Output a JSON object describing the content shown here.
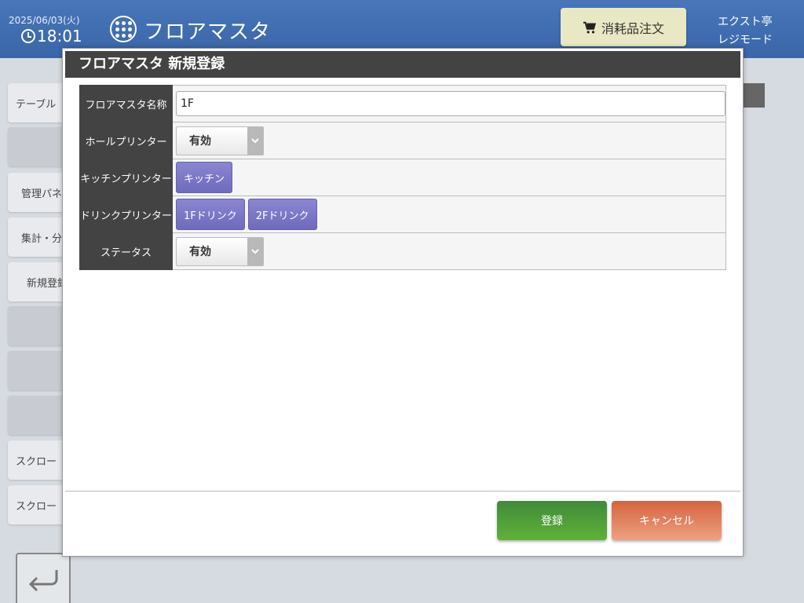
{
  "header": {
    "date": "2025/06/03(火)",
    "time": "18:01",
    "app_title": "フロアマスタ",
    "order_button": "消耗品注文",
    "store_name": "エクスト亭",
    "mode": "レジモード"
  },
  "sidebar": {
    "items": [
      {
        "label": "テーブル"
      },
      {
        "label": ""
      },
      {
        "label": "管理パネ"
      },
      {
        "label": "集計・分"
      },
      {
        "label": "新規登録"
      },
      {
        "label": ""
      },
      {
        "label": ""
      },
      {
        "label": ""
      },
      {
        "label": "スクロー"
      },
      {
        "label": "スクロー"
      }
    ]
  },
  "modal": {
    "title": "フロアマスタ 新規登録",
    "fields": {
      "name": {
        "label": "フロアマスタ名称",
        "value": "1F"
      },
      "hall_printer": {
        "label": "ホールプリンター",
        "value": "有効"
      },
      "kitchen_printer": {
        "label": "キッチンプリンター",
        "buttons": [
          "キッチン"
        ]
      },
      "drink_printer": {
        "label": "ドリンクプリンター",
        "buttons": [
          "1Fドリンク",
          "2Fドリンク"
        ]
      },
      "status": {
        "label": "ステータス",
        "value": "有効"
      }
    },
    "register_button": "登録",
    "cancel_button": "キャンセル"
  },
  "colors": {
    "header_bg": "#3a66a8",
    "register": "#4f9e39",
    "cancel": "#e0806a",
    "printer_btn": "#7a76c6"
  }
}
